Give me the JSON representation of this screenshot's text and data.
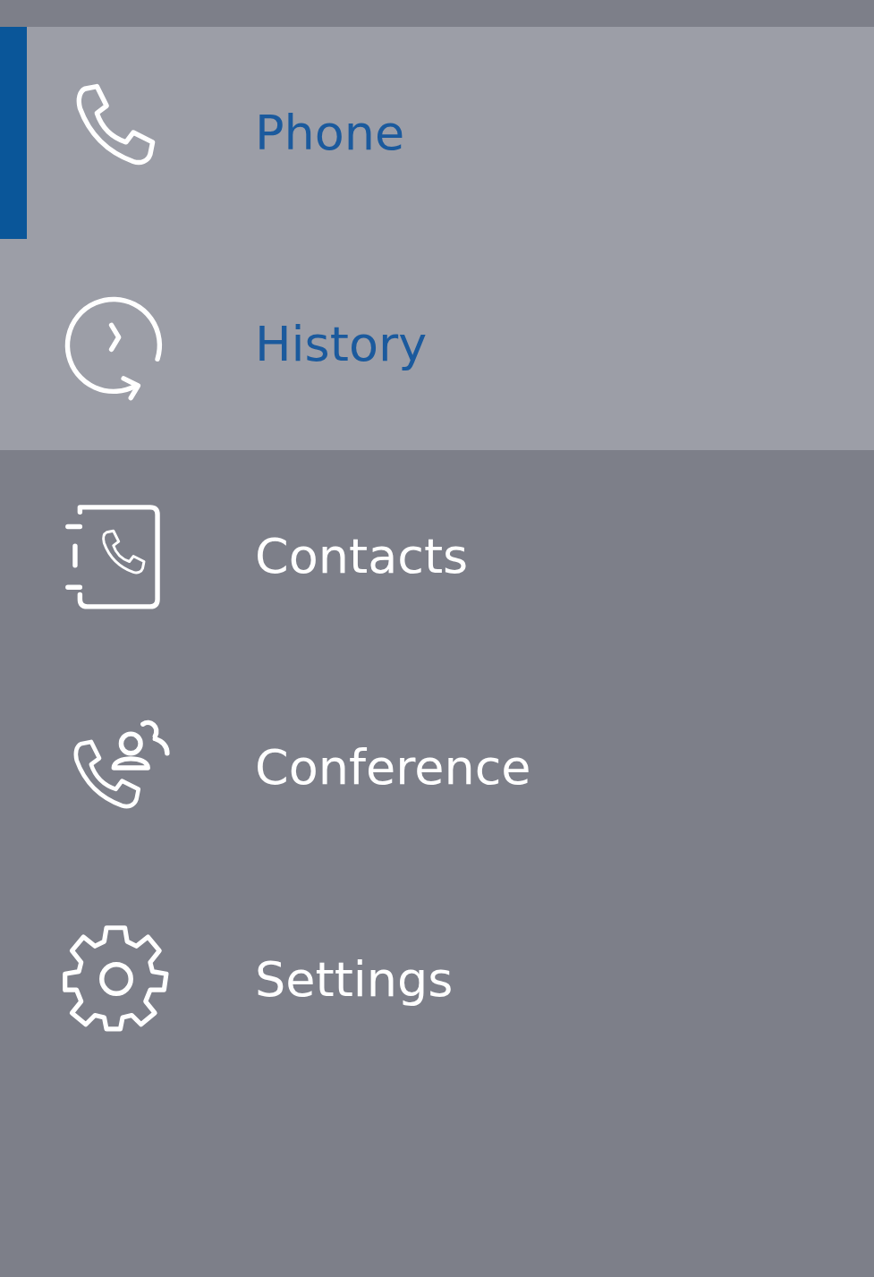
{
  "sidebar": {
    "items": [
      {
        "kind": "phone",
        "label": "Phone",
        "selected": true,
        "highlighted": true
      },
      {
        "kind": "history",
        "label": "History",
        "selected": false,
        "highlighted": true
      },
      {
        "kind": "contacts",
        "label": "Contacts",
        "selected": false,
        "highlighted": false
      },
      {
        "kind": "conference",
        "label": "Conference",
        "selected": false,
        "highlighted": false
      },
      {
        "kind": "settings",
        "label": "Settings",
        "selected": false,
        "highlighted": false
      }
    ]
  }
}
